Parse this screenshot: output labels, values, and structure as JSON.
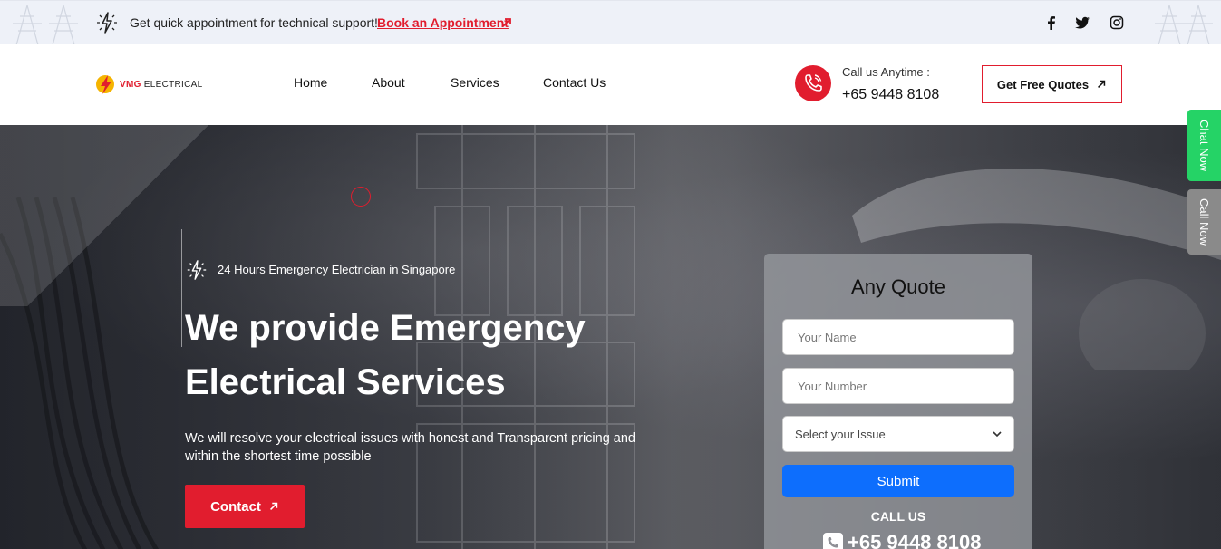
{
  "topbar": {
    "message": "Get quick appointment for technical support!",
    "appointment_link": "Book an Appointment",
    "social": [
      "facebook-icon",
      "twitter-icon",
      "instagram-icon"
    ]
  },
  "header": {
    "logo_brand": "VMG",
    "logo_suffix": "ELECTRICAL",
    "nav": [
      "Home",
      "About",
      "Services",
      "Contact Us"
    ],
    "call_label": "Call us Anytime :",
    "call_number": "+65 9448 8108",
    "quote_button": "Get Free Quotes"
  },
  "hero": {
    "tagline": "24 Hours Emergency Electrician in Singapore",
    "heading_line1": "We provide Emergency",
    "heading_line2": "Electrical Services",
    "description": "We will resolve your electrical issues with honest and Transparent pricing and within the shortest time possible",
    "contact_button": "Contact"
  },
  "quote_form": {
    "title": "Any Quote",
    "name_placeholder": "Your Name",
    "number_placeholder": "Your Number",
    "issue_select": "Select your Issue",
    "submit": "Submit",
    "call_us": "CALL US",
    "call_number": "+65 9448 8108"
  },
  "side_tabs": {
    "chat": "Chat Now",
    "call": "Call Now"
  },
  "colors": {
    "accent_red": "#e11d2e",
    "submit_blue": "#0d6efd",
    "chat_green": "#25d366",
    "call_gray": "#8a8a8a"
  }
}
